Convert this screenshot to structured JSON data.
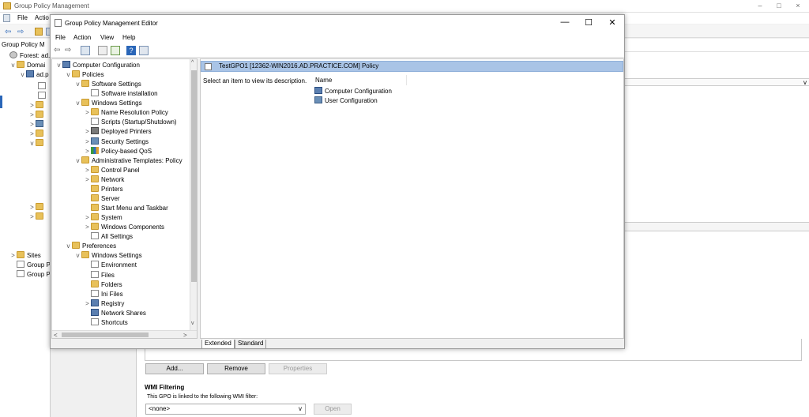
{
  "background": {
    "title": "Group Policy Management",
    "menu": [
      "File",
      "Actio"
    ],
    "tree": [
      "Group Policy M",
      "Forest: ad.p",
      "Domai",
      "ad.p",
      "Sites",
      "Group P",
      "Group P"
    ],
    "buttons": {
      "add": "Add...",
      "remove": "Remove",
      "properties": "Properties"
    },
    "wmi": {
      "heading": "WMI Filtering",
      "text": "This GPO is linked to the following WMI filter:",
      "value": "<none>",
      "open": "Open"
    },
    "controls": {
      "minimize": "–",
      "maximize": "□",
      "close": "×"
    }
  },
  "editor": {
    "title": "Group Policy Management Editor",
    "controls": {
      "minimize": "—",
      "maximize": "☐",
      "close": "✕"
    },
    "menu": [
      "File",
      "Action",
      "View",
      "Help"
    ],
    "tree": [
      {
        "label": "Computer Configuration",
        "icon": "computer-icon",
        "indent": 0,
        "expand": "v"
      },
      {
        "label": "Policies",
        "icon": "folder-icon",
        "indent": 1,
        "expand": "v"
      },
      {
        "label": "Software Settings",
        "icon": "folder-icon",
        "indent": 2,
        "expand": "v"
      },
      {
        "label": "Software installation",
        "icon": "package-icon",
        "indent": 3,
        "expand": ""
      },
      {
        "label": "Windows Settings",
        "icon": "folder-icon",
        "indent": 2,
        "expand": "v"
      },
      {
        "label": "Name Resolution Policy",
        "icon": "folder-icon",
        "indent": 3,
        "expand": ">"
      },
      {
        "label": "Scripts (Startup/Shutdown)",
        "icon": "script-icon",
        "indent": 3,
        "expand": ""
      },
      {
        "label": "Deployed Printers",
        "icon": "printer-icon",
        "indent": 3,
        "expand": ">"
      },
      {
        "label": "Security Settings",
        "icon": "shield-icon",
        "indent": 3,
        "expand": ">"
      },
      {
        "label": "Policy-based QoS",
        "icon": "chart-icon",
        "indent": 3,
        "expand": ">"
      },
      {
        "label": "Administrative Templates: Policy",
        "icon": "folder-icon",
        "indent": 2,
        "expand": "v"
      },
      {
        "label": "Control Panel",
        "icon": "folder-icon",
        "indent": 3,
        "expand": ">"
      },
      {
        "label": "Network",
        "icon": "folder-icon",
        "indent": 3,
        "expand": ">"
      },
      {
        "label": "Printers",
        "icon": "folder-icon",
        "indent": 3,
        "expand": ""
      },
      {
        "label": "Server",
        "icon": "folder-icon",
        "indent": 3,
        "expand": ""
      },
      {
        "label": "Start Menu and Taskbar",
        "icon": "folder-icon",
        "indent": 3,
        "expand": ""
      },
      {
        "label": "System",
        "icon": "folder-icon",
        "indent": 3,
        "expand": ">"
      },
      {
        "label": "Windows Components",
        "icon": "folder-icon",
        "indent": 3,
        "expand": ">"
      },
      {
        "label": "All Settings",
        "icon": "settings-icon",
        "indent": 3,
        "expand": ""
      },
      {
        "label": "Preferences",
        "icon": "folder-icon",
        "indent": 1,
        "expand": "v"
      },
      {
        "label": "Windows Settings",
        "icon": "folder-icon",
        "indent": 2,
        "expand": "v"
      },
      {
        "label": "Environment",
        "icon": "environment-icon",
        "indent": 3,
        "expand": ""
      },
      {
        "label": "Files",
        "icon": "files-icon",
        "indent": 3,
        "expand": ""
      },
      {
        "label": "Folders",
        "icon": "folder-icon",
        "indent": 3,
        "expand": ""
      },
      {
        "label": "Ini Files",
        "icon": "ini-file-icon",
        "indent": 3,
        "expand": ""
      },
      {
        "label": "Registry",
        "icon": "registry-icon",
        "indent": 3,
        "expand": ">"
      },
      {
        "label": "Network Shares",
        "icon": "network-share-icon",
        "indent": 3,
        "expand": ""
      },
      {
        "label": "Shortcuts",
        "icon": "shortcut-icon",
        "indent": 3,
        "expand": ""
      }
    ],
    "main": {
      "header": "TestGPO1 [12362-WIN2016.AD.PRACTICE.COM] Policy",
      "description": "Select an item to view its description.",
      "column_name": "Name",
      "items": [
        "Computer Configuration",
        "User Configuration"
      ]
    },
    "tabs": [
      "Extended",
      "Standard"
    ]
  }
}
